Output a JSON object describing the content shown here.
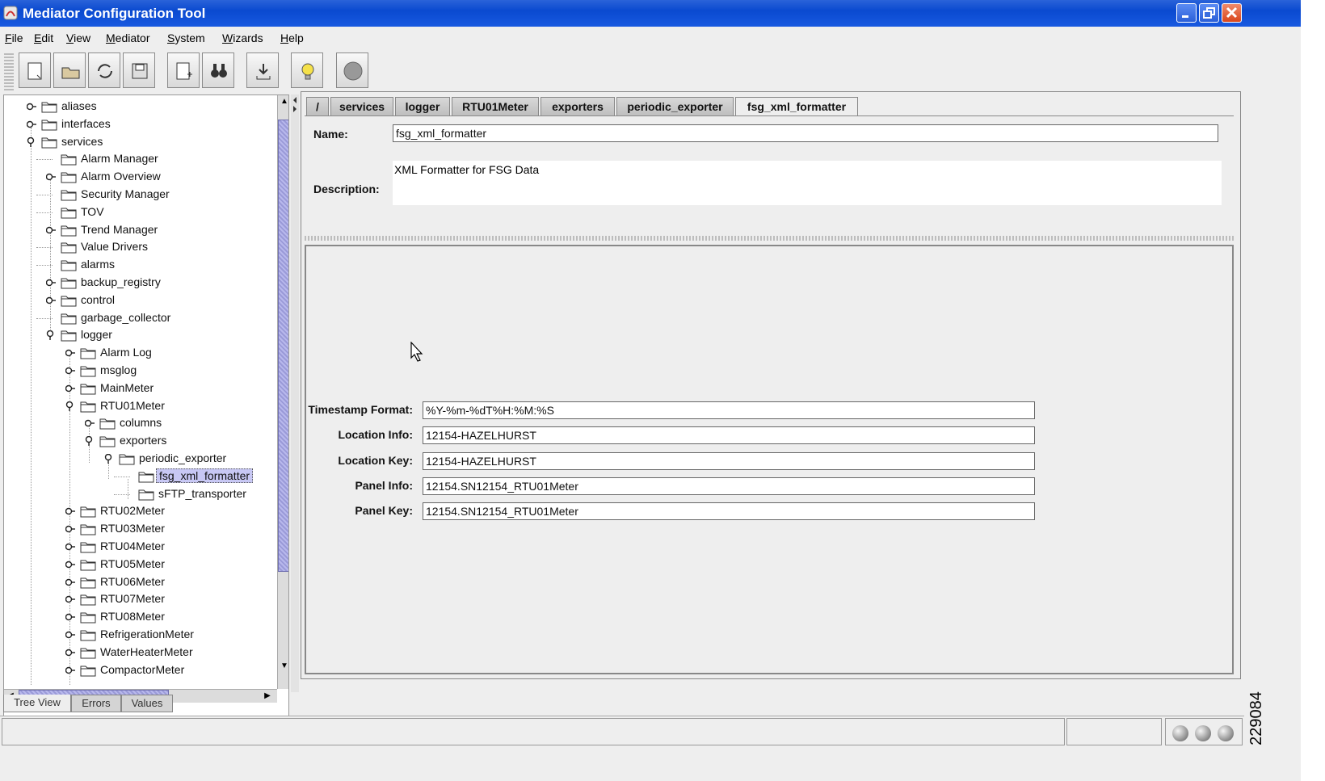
{
  "window": {
    "title": "Mediator Configuration Tool"
  },
  "menu": [
    {
      "label": "File",
      "u": "F"
    },
    {
      "label": "Edit",
      "u": "E"
    },
    {
      "label": "View",
      "u": "V"
    },
    {
      "label": "Mediator",
      "u": "M"
    },
    {
      "label": "System",
      "u": "S"
    },
    {
      "label": "Wizards",
      "u": "W"
    },
    {
      "label": "Help",
      "u": "H"
    }
  ],
  "toolbar": [
    "new-document-icon",
    "open-folder-icon",
    "refresh-icon",
    "save-disk-icon",
    "new-page-icon",
    "binoculars-icon",
    "download-icon",
    "lightbulb-icon",
    "stop-icon"
  ],
  "tree": [
    {
      "label": "aliases",
      "depth": 0,
      "toggle": "collapsed"
    },
    {
      "label": "interfaces",
      "depth": 0,
      "toggle": "collapsed"
    },
    {
      "label": "services",
      "depth": 0,
      "toggle": "expanded"
    },
    {
      "label": "Alarm Manager",
      "depth": 1,
      "toggle": "none"
    },
    {
      "label": "Alarm Overview",
      "depth": 1,
      "toggle": "collapsed"
    },
    {
      "label": "Security Manager",
      "depth": 1,
      "toggle": "none"
    },
    {
      "label": "TOV",
      "depth": 1,
      "toggle": "none"
    },
    {
      "label": "Trend Manager",
      "depth": 1,
      "toggle": "collapsed"
    },
    {
      "label": "Value Drivers",
      "depth": 1,
      "toggle": "none"
    },
    {
      "label": "alarms",
      "depth": 1,
      "toggle": "none"
    },
    {
      "label": "backup_registry",
      "depth": 1,
      "toggle": "collapsed"
    },
    {
      "label": "control",
      "depth": 1,
      "toggle": "collapsed"
    },
    {
      "label": "garbage_collector",
      "depth": 1,
      "toggle": "none"
    },
    {
      "label": "logger",
      "depth": 1,
      "toggle": "expanded"
    },
    {
      "label": "Alarm Log",
      "depth": 2,
      "toggle": "collapsed"
    },
    {
      "label": "msglog",
      "depth": 2,
      "toggle": "collapsed"
    },
    {
      "label": "MainMeter",
      "depth": 2,
      "toggle": "collapsed"
    },
    {
      "label": "RTU01Meter",
      "depth": 2,
      "toggle": "expanded"
    },
    {
      "label": "columns",
      "depth": 3,
      "toggle": "collapsed"
    },
    {
      "label": "exporters",
      "depth": 3,
      "toggle": "expanded"
    },
    {
      "label": "periodic_exporter",
      "depth": 4,
      "toggle": "expanded"
    },
    {
      "label": "fsg_xml_formatter",
      "depth": 5,
      "toggle": "none",
      "selected": true
    },
    {
      "label": "sFTP_transporter",
      "depth": 5,
      "toggle": "none"
    },
    {
      "label": "RTU02Meter",
      "depth": 2,
      "toggle": "collapsed"
    },
    {
      "label": "RTU03Meter",
      "depth": 2,
      "toggle": "collapsed"
    },
    {
      "label": "RTU04Meter",
      "depth": 2,
      "toggle": "collapsed"
    },
    {
      "label": "RTU05Meter",
      "depth": 2,
      "toggle": "collapsed"
    },
    {
      "label": "RTU06Meter",
      "depth": 2,
      "toggle": "collapsed"
    },
    {
      "label": "RTU07Meter",
      "depth": 2,
      "toggle": "collapsed"
    },
    {
      "label": "RTU08Meter",
      "depth": 2,
      "toggle": "collapsed"
    },
    {
      "label": "RefrigerationMeter",
      "depth": 2,
      "toggle": "collapsed"
    },
    {
      "label": "WaterHeaterMeter",
      "depth": 2,
      "toggle": "collapsed"
    },
    {
      "label": "CompactorMeter",
      "depth": 2,
      "toggle": "collapsed"
    }
  ],
  "breadcrumb_tabs": [
    "/",
    "services",
    "logger",
    "RTU01Meter",
    "exporters",
    "periodic_exporter",
    "fsg_xml_formatter"
  ],
  "form": {
    "name_label": "Name:",
    "name_value": "fsg_xml_formatter",
    "description_label": "Description:",
    "description_value": "XML Formatter for FSG Data"
  },
  "fields": [
    {
      "label": "Timestamp Format:",
      "value": "%Y-%m-%dT%H:%M:%S"
    },
    {
      "label": "Location Info:",
      "value": "12154-HAZELHURST"
    },
    {
      "label": "Location Key:",
      "value": "12154-HAZELHURST"
    },
    {
      "label": "Panel Info:",
      "value": "12154.SN12154_RTU01Meter"
    },
    {
      "label": "Panel Key:",
      "value": "12154.SN12154_RTU01Meter"
    }
  ],
  "bottom_tabs": [
    "Tree View",
    "Errors",
    "Values"
  ],
  "figure_id": "229084"
}
